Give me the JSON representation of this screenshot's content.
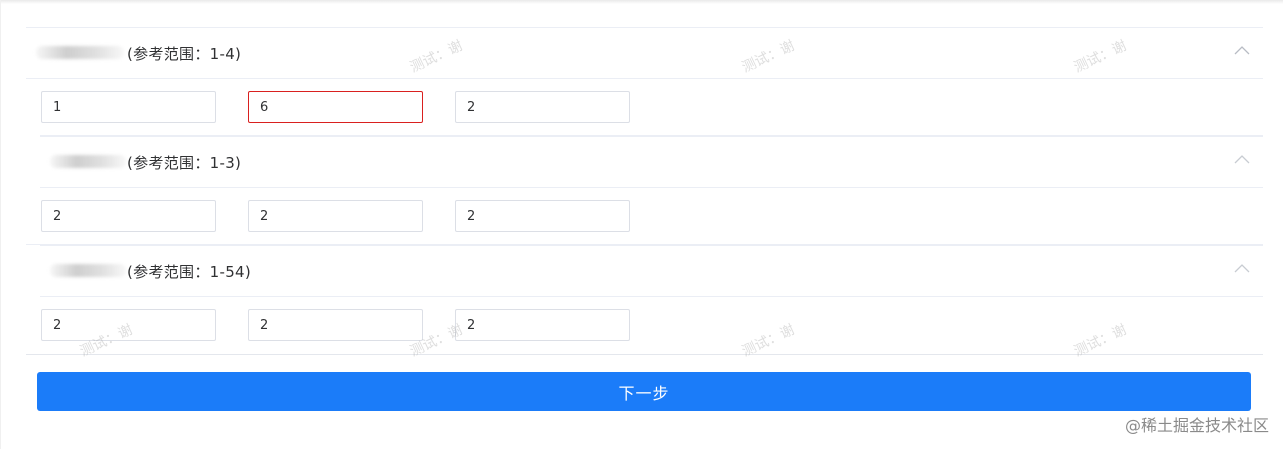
{
  "sections": [
    {
      "title": "(参考范围：1-4)",
      "values": [
        "1",
        "6",
        "2"
      ],
      "error_index": 1
    },
    {
      "title": "(参考范围：1-3)",
      "values": [
        "2",
        "2",
        "2"
      ]
    },
    {
      "title": "(参考范围：1-54)",
      "values": [
        "2",
        "2",
        "2"
      ]
    }
  ],
  "next_button": "下一步",
  "watermark": "测试：谢",
  "credit": "@稀土掘金技术社区",
  "colors": {
    "primary": "#1b7cf9",
    "error_border": "#d9201f",
    "divider": "#ebeef5"
  }
}
